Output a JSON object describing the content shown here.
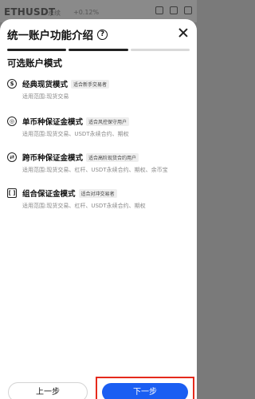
{
  "background_header": {
    "pair": "ETHUSDT",
    "meta": "永续",
    "change": "+0.12%"
  },
  "sheet": {
    "title": "统一账户功能介绍",
    "help_icon_glyph": "?",
    "section_title": "可选账户模式",
    "modes": [
      {
        "name": "经典现货模式",
        "tag": "适合新手交易者",
        "desc": "适用范围:现货交易",
        "icon": "classic-spot-icon",
        "glyph": "$"
      },
      {
        "name": "单币种保证金模式",
        "tag": "适合风控保守用户",
        "desc": "适用范围:现货交易、USDT永续合约、期权",
        "icon": "single-margin-icon",
        "glyph": "◎"
      },
      {
        "name": "跨币种保证金模式",
        "tag": "适合高阶现货合约用户",
        "desc": "适用范围:现货交易、杠杆、USDT永续合约、期权、余币宝",
        "icon": "multi-margin-icon",
        "glyph": "⇄"
      },
      {
        "name": "组合保证金模式",
        "tag": "适合对冲交易者",
        "desc": "适用范围:现货交易、杠杆、USDT永续合约、期权",
        "icon": "portfolio-margin-icon",
        "glyph": "[ ]"
      }
    ]
  },
  "progress": {
    "total_steps": 3,
    "current_step": 2
  },
  "footer": {
    "prev_label": "上一步",
    "next_label": "下一步"
  },
  "colors": {
    "accent": "#1a5ef2",
    "highlight_frame": "#e52a1c"
  }
}
